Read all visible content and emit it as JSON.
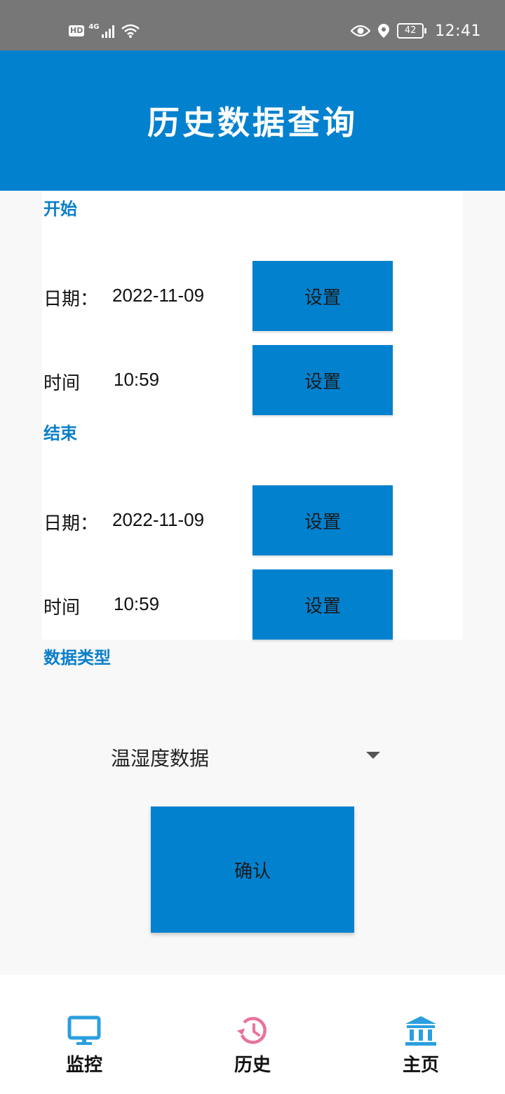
{
  "status_bar": {
    "hd": "HD",
    "network": "4G",
    "battery": "42",
    "time": "12:41",
    "icons": [
      "signal-icon",
      "wifi-icon",
      "eye-icon",
      "location-icon",
      "battery-icon"
    ]
  },
  "header": {
    "title": "历史数据查询",
    "background": "#0281cf"
  },
  "start": {
    "section_label": "开始",
    "date_label": "日期：",
    "date_value": "2022-11-09",
    "date_button": "设置",
    "time_label": "时间",
    "time_value": "10:59",
    "time_button": "设置"
  },
  "end": {
    "section_label": "结束",
    "date_label": "日期：",
    "date_value": "2022-11-09",
    "date_button": "设置",
    "time_label": "时间",
    "time_value": "10:59",
    "time_button": "设置"
  },
  "data_type": {
    "section_label": "数据类型",
    "selected": "温湿度数据"
  },
  "confirm": {
    "label": "确认"
  },
  "bottom_nav": {
    "items": [
      {
        "label": "监控",
        "icon": "monitor-icon",
        "color": "#2a9fdf"
      },
      {
        "label": "历史",
        "icon": "history-icon",
        "color": "#e8739a"
      },
      {
        "label": "主页",
        "icon": "bank-icon",
        "color": "#2a9fdf"
      }
    ]
  },
  "colors": {
    "accent": "#0281cf",
    "section_label": "#0a7fc9"
  }
}
